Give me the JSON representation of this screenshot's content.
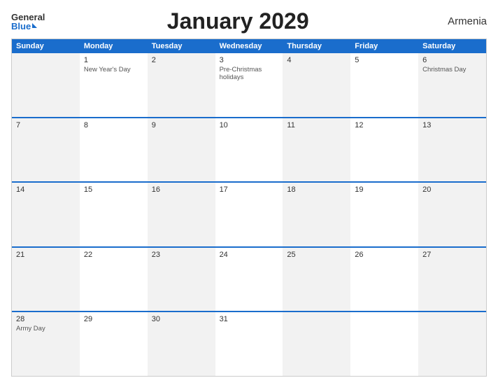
{
  "header": {
    "logo_general": "General",
    "logo_blue": "Blue",
    "title": "January 2029",
    "country": "Armenia"
  },
  "calendar": {
    "days_of_week": [
      "Sunday",
      "Monday",
      "Tuesday",
      "Wednesday",
      "Thursday",
      "Friday",
      "Saturday"
    ],
    "weeks": [
      [
        {
          "day": "",
          "holiday": "",
          "class": "sunday empty"
        },
        {
          "day": "1",
          "holiday": "New Year's Day",
          "class": "monday"
        },
        {
          "day": "2",
          "holiday": "",
          "class": "tuesday"
        },
        {
          "day": "3",
          "holiday": "Pre-Christmas holidays",
          "class": "wednesday"
        },
        {
          "day": "4",
          "holiday": "",
          "class": "thursday"
        },
        {
          "day": "5",
          "holiday": "",
          "class": "friday"
        },
        {
          "day": "6",
          "holiday": "Christmas Day",
          "class": "saturday"
        }
      ],
      [
        {
          "day": "7",
          "holiday": "",
          "class": "sunday"
        },
        {
          "day": "8",
          "holiday": "",
          "class": "monday"
        },
        {
          "day": "9",
          "holiday": "",
          "class": "tuesday"
        },
        {
          "day": "10",
          "holiday": "",
          "class": "wednesday"
        },
        {
          "day": "11",
          "holiday": "",
          "class": "thursday"
        },
        {
          "day": "12",
          "holiday": "",
          "class": "friday"
        },
        {
          "day": "13",
          "holiday": "",
          "class": "saturday"
        }
      ],
      [
        {
          "day": "14",
          "holiday": "",
          "class": "sunday"
        },
        {
          "day": "15",
          "holiday": "",
          "class": "monday"
        },
        {
          "day": "16",
          "holiday": "",
          "class": "tuesday"
        },
        {
          "day": "17",
          "holiday": "",
          "class": "wednesday"
        },
        {
          "day": "18",
          "holiday": "",
          "class": "thursday"
        },
        {
          "day": "19",
          "holiday": "",
          "class": "friday"
        },
        {
          "day": "20",
          "holiday": "",
          "class": "saturday"
        }
      ],
      [
        {
          "day": "21",
          "holiday": "",
          "class": "sunday"
        },
        {
          "day": "22",
          "holiday": "",
          "class": "monday"
        },
        {
          "day": "23",
          "holiday": "",
          "class": "tuesday"
        },
        {
          "day": "24",
          "holiday": "",
          "class": "wednesday"
        },
        {
          "day": "25",
          "holiday": "",
          "class": "thursday"
        },
        {
          "day": "26",
          "holiday": "",
          "class": "friday"
        },
        {
          "day": "27",
          "holiday": "",
          "class": "saturday"
        }
      ],
      [
        {
          "day": "28",
          "holiday": "Army Day",
          "class": "sunday"
        },
        {
          "day": "29",
          "holiday": "",
          "class": "monday"
        },
        {
          "day": "30",
          "holiday": "",
          "class": "tuesday"
        },
        {
          "day": "31",
          "holiday": "",
          "class": "wednesday"
        },
        {
          "day": "",
          "holiday": "",
          "class": "thursday empty"
        },
        {
          "day": "",
          "holiday": "",
          "class": "friday empty"
        },
        {
          "day": "",
          "holiday": "",
          "class": "saturday empty"
        }
      ]
    ]
  }
}
